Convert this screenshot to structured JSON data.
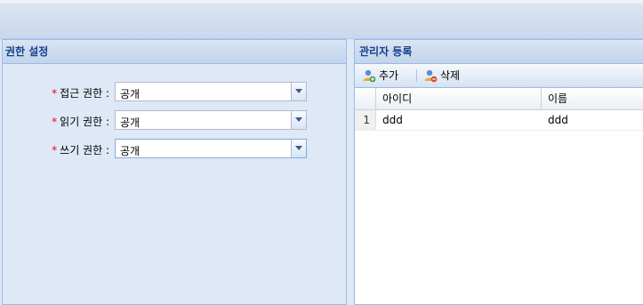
{
  "left_panel": {
    "title": "권한 설정",
    "fields": [
      {
        "label": "접근 권한 :",
        "value": "공개",
        "required_mark": "*"
      },
      {
        "label": "읽기 권한 :",
        "value": "공개",
        "required_mark": "*"
      },
      {
        "label": "쓰기 권한 :",
        "value": "공개",
        "required_mark": "*"
      }
    ]
  },
  "right_panel": {
    "title": "관리자 등록",
    "toolbar": {
      "add_label": "추가",
      "delete_label": "삭제",
      "add_icon": "user-add-icon",
      "delete_icon": "user-delete-icon"
    },
    "grid": {
      "columns": [
        "아이디",
        "이름"
      ],
      "rows": [
        {
          "num": "1",
          "cells": [
            "ddd",
            "ddd"
          ]
        }
      ]
    }
  },
  "colors": {
    "header_text": "#15428b",
    "panel_bg": "#dfe8f6",
    "border": "#99bbe8",
    "required": "#ff0000"
  }
}
